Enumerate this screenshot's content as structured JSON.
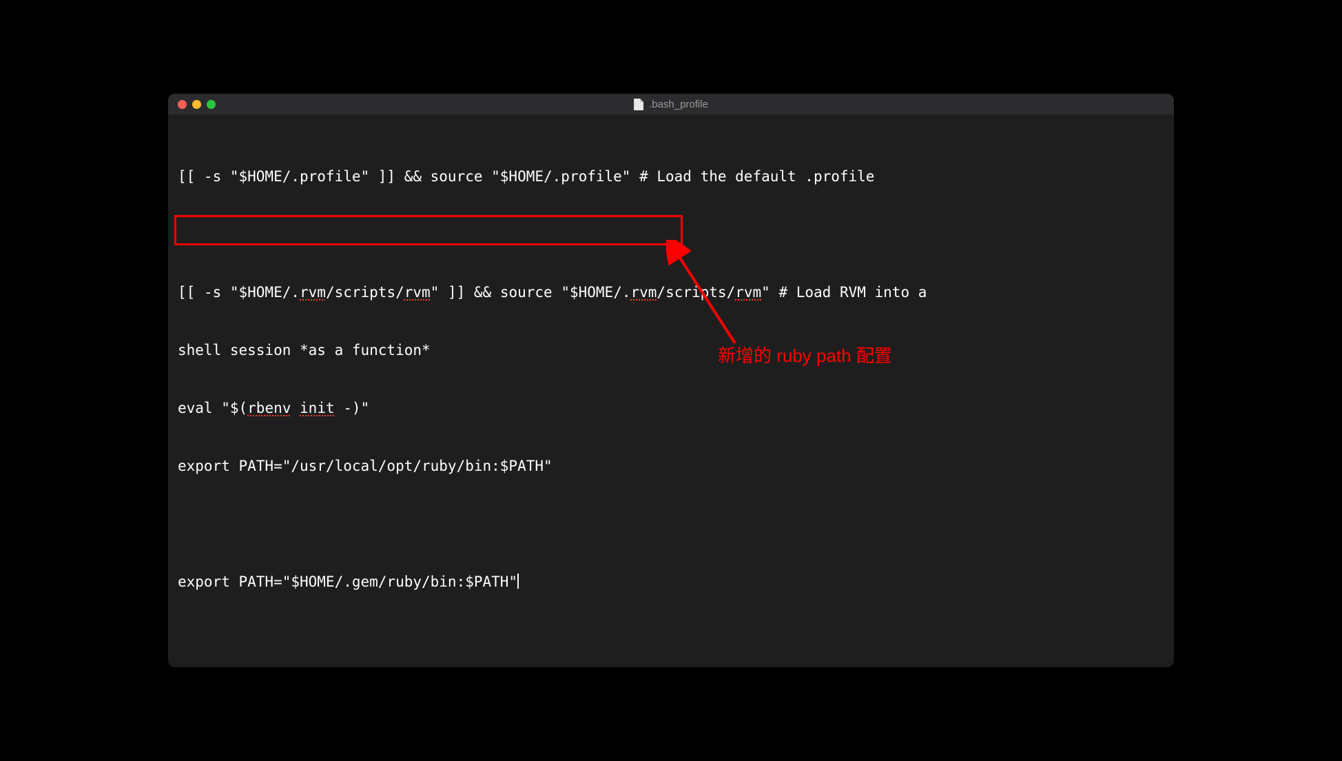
{
  "window": {
    "title": ".bash_profile"
  },
  "editor": {
    "lines": {
      "l1_prefix": "[[ -s \"$HOME/.profile\" ]] && source \"$HOME/.profile\" # Load the default .profile",
      "l2_blank": "",
      "l3_prefix": "[[ -s \"$HOME/.",
      "l3_rvm1": "rvm",
      "l3_mid1": "/scripts/",
      "l3_rvm2": "rvm",
      "l3_mid2": "\" ]] && source \"$HOME/.",
      "l3_rvm3": "rvm",
      "l3_mid3": "/scripts/",
      "l3_rvm4": "rvm",
      "l3_suffix": "\" # Load RVM into a ",
      "l4": "shell session *as a function*",
      "l5_prefix": "eval \"$(",
      "l5_rbenv": "rbenv",
      "l5_mid": " ",
      "l5_init": "init",
      "l5_suffix": " -)\"",
      "l6": "export PATH=\"/usr/local/opt/ruby/bin:$PATH\"",
      "l7_blank": "",
      "l8": "export PATH=\"$HOME/.gem/ruby/bin:$PATH\""
    }
  },
  "annotation": {
    "label": "新增的 ruby path 配置"
  }
}
